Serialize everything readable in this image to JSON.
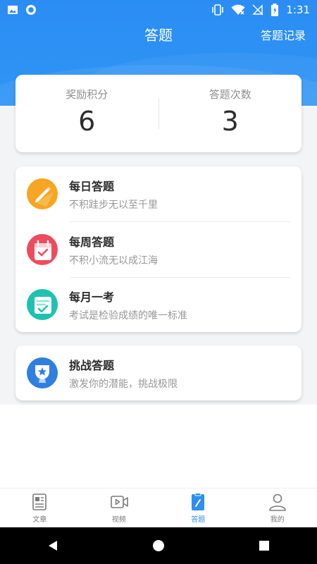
{
  "status_bar": {
    "time": "1:31"
  },
  "header": {
    "title": "答题",
    "action": "答题记录"
  },
  "stats": {
    "points": {
      "label": "奖励积分",
      "value": "6"
    },
    "count": {
      "label": "答题次数",
      "value": "3"
    }
  },
  "quiz_items": [
    {
      "title": "每日答题",
      "subtitle": "不积跬步无以至千里",
      "icon": "pencil-icon",
      "color": "#f6a623"
    },
    {
      "title": "每周答题",
      "subtitle": "不积小流无以成江海",
      "icon": "calendar-icon",
      "color": "#ef4b5f"
    },
    {
      "title": "每月一考",
      "subtitle": "考试是检验成绩的唯一标准",
      "icon": "checklist-icon",
      "color": "#1fc1b1"
    }
  ],
  "challenge": {
    "title": "挑战答题",
    "subtitle": "激发你的潜能，挑战极限",
    "icon": "trophy-icon",
    "color": "#2f7fe0"
  },
  "tabs": [
    {
      "label": "文章",
      "icon": "article-icon"
    },
    {
      "label": "视频",
      "icon": "video-icon"
    },
    {
      "label": "答题",
      "icon": "quiz-icon",
      "active": true
    },
    {
      "label": "我的",
      "icon": "profile-icon"
    }
  ],
  "colors": {
    "accent": "#2f8ef3",
    "tab_inactive": "#7a7a7a"
  }
}
